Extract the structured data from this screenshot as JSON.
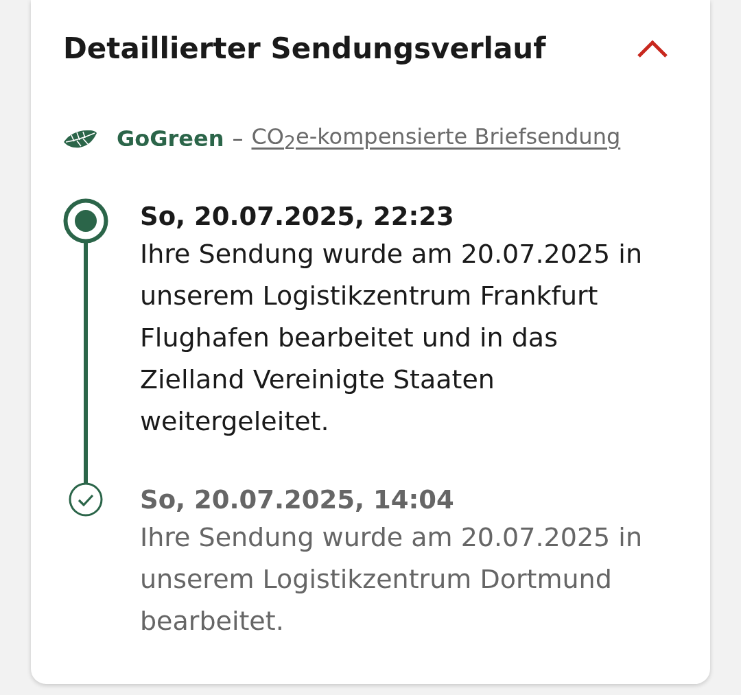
{
  "history": {
    "title": "Detaillierter Sendungsverlauf",
    "expanded": true,
    "gogreen": {
      "label": "GoGreen",
      "separator": "–",
      "link": "CO$_{2}$e-kompensierte Briefsendung"
    },
    "events": [
      {
        "kind": "current",
        "time": "So, 20.07.2025, 22:23",
        "text": "Ihre Sendung wurde am 20.07.2025 in unserem Logistikzentrum Frankfurt Flughafen bearbeitet und in das Zielland Vereinigte Staaten weitergeleitet."
      },
      {
        "kind": "completed",
        "time": "So, 20.07.2025, 14:04",
        "text": "Ihre Sendung wurde am 20.07.2025 in unserem Logistikzentrum Dortmund bearbeitet."
      }
    ]
  }
}
